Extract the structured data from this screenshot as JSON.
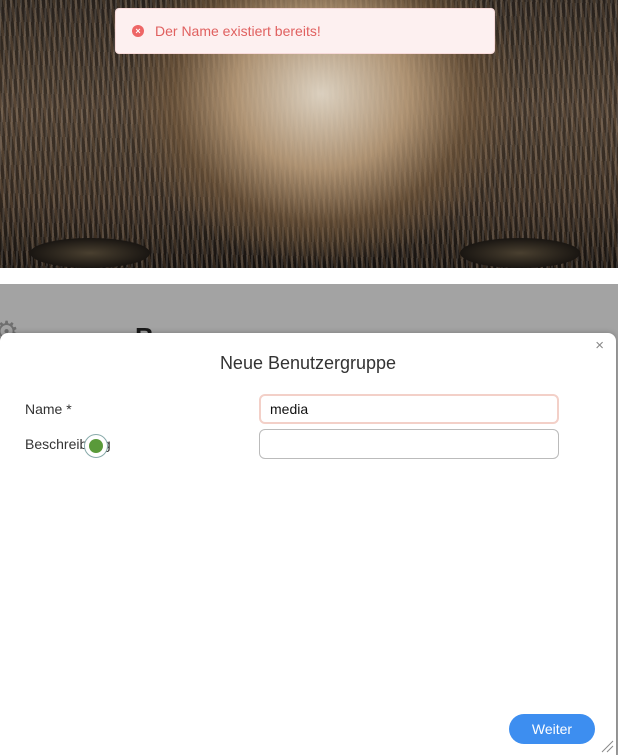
{
  "toast": {
    "message": "Der Name existiert bereits!",
    "icon": "error-circle-icon",
    "color": "#e0605f"
  },
  "background": {
    "heading": "B n t"
  },
  "dialog": {
    "title": "Neue Benutzergruppe",
    "close_label": "×",
    "fields": {
      "name": {
        "label": "Name *",
        "value": "media"
      },
      "description": {
        "label": "Beschreibung",
        "value": ""
      }
    },
    "next_label": "Weiter",
    "accent_color": "#3d8ef0"
  }
}
